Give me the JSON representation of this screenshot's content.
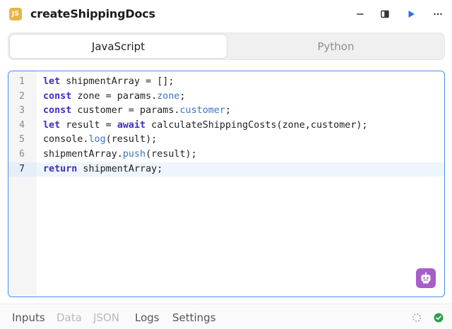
{
  "header": {
    "badge": "JS",
    "title": "createShippingDocs",
    "icons": [
      "minimize-icon",
      "split-panel-icon",
      "run-icon",
      "more-icon"
    ]
  },
  "language_tabs": [
    {
      "label": "JavaScript",
      "selected": true
    },
    {
      "label": "Python",
      "selected": false
    }
  ],
  "editor": {
    "active_line": 7,
    "lines": [
      {
        "num": "1",
        "tokens": [
          {
            "t": "let",
            "c": "kw"
          },
          {
            "t": " shipmentArray = [];",
            "c": ""
          }
        ]
      },
      {
        "num": "2",
        "tokens": [
          {
            "t": "const",
            "c": "kw"
          },
          {
            "t": " zone = params.",
            "c": ""
          },
          {
            "t": "zone",
            "c": "prop"
          },
          {
            "t": ";",
            "c": ""
          }
        ]
      },
      {
        "num": "3",
        "tokens": [
          {
            "t": "const",
            "c": "kw"
          },
          {
            "t": " customer = params.",
            "c": ""
          },
          {
            "t": "customer",
            "c": "prop"
          },
          {
            "t": ";",
            "c": ""
          }
        ]
      },
      {
        "num": "4",
        "tokens": [
          {
            "t": "let",
            "c": "kw"
          },
          {
            "t": " result = ",
            "c": ""
          },
          {
            "t": "await",
            "c": "kw"
          },
          {
            "t": " calculateShippingCosts(zone,customer);",
            "c": ""
          }
        ]
      },
      {
        "num": "5",
        "tokens": [
          {
            "t": "console.",
            "c": ""
          },
          {
            "t": "log",
            "c": "prop"
          },
          {
            "t": "(result);",
            "c": ""
          }
        ]
      },
      {
        "num": "6",
        "tokens": [
          {
            "t": "shipmentArray.",
            "c": ""
          },
          {
            "t": "push",
            "c": "prop"
          },
          {
            "t": "(result);",
            "c": ""
          }
        ]
      },
      {
        "num": "7",
        "tokens": [
          {
            "t": "return",
            "c": "kw"
          },
          {
            "t": " shipmentArray;",
            "c": ""
          }
        ]
      }
    ],
    "assistant_icon": "robot-assistant-icon"
  },
  "bottom_tabs": [
    {
      "label": "Inputs",
      "enabled": true
    },
    {
      "label": "Data",
      "enabled": false
    },
    {
      "label": "JSON",
      "enabled": false
    },
    {
      "label": "Logs",
      "enabled": true
    },
    {
      "label": "Settings",
      "enabled": true
    }
  ],
  "status_icons": [
    "loading-spinner-icon",
    "success-check-icon"
  ],
  "colors": {
    "badge": "#e9b44c",
    "keyword": "#3d2ec2",
    "property": "#3a75c4",
    "focus_border": "#4a8cf0",
    "run": "#2f6fe8",
    "assistant": "#a75fc7",
    "success": "#2e9e4f"
  }
}
